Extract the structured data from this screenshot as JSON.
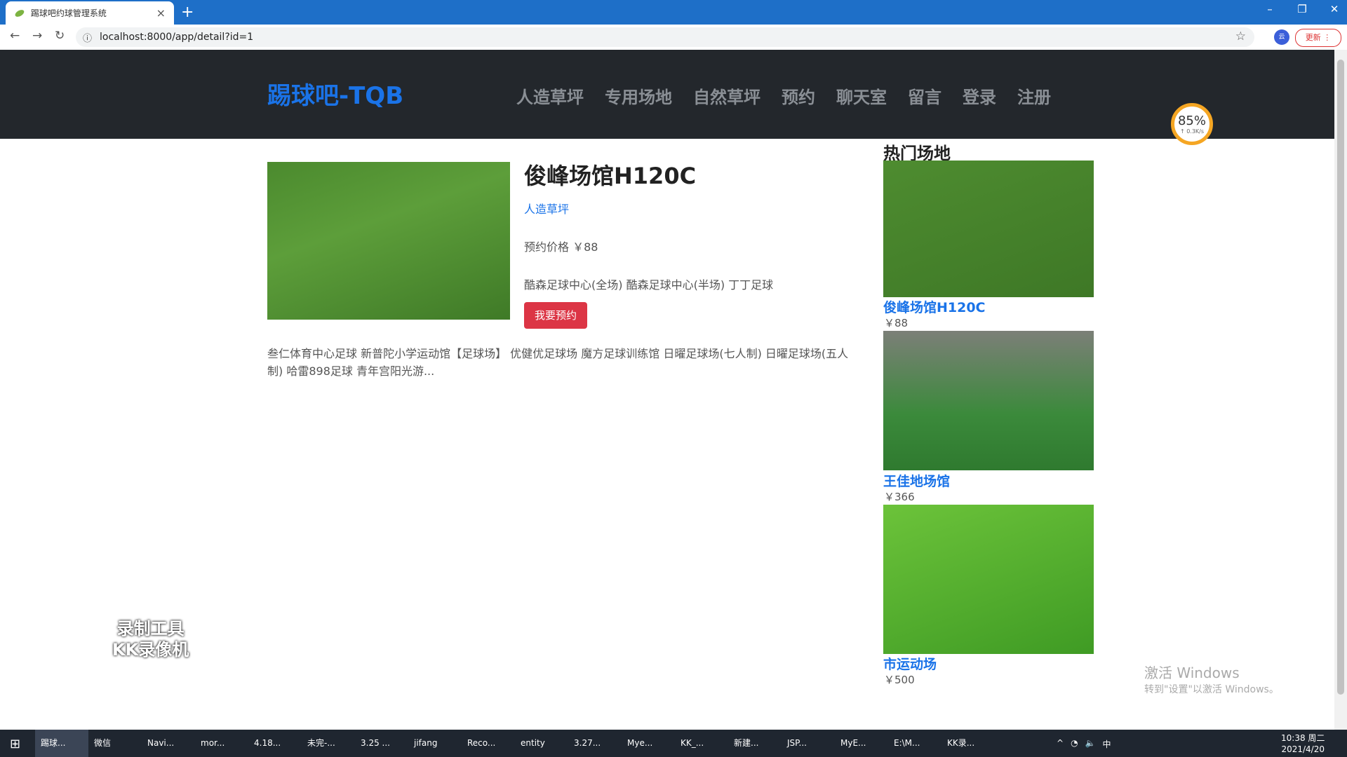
{
  "browser": {
    "tab_title": "踢球吧约球管理系统",
    "tab_close": "×",
    "new_tab": "+",
    "url": "localhost:8000/app/detail?id=1",
    "extension_label": "云",
    "update_label": "更新 ⋮"
  },
  "site": {
    "brand": "踢球吧-TQB",
    "nav": [
      "人造草坪",
      "专用场地",
      "自然草坪",
      "预约",
      "聊天室",
      "留言",
      "登录",
      "注册"
    ]
  },
  "speed_widget": {
    "percent": "85%",
    "rate": "↑ 0.3K/s"
  },
  "detail": {
    "title": "俊峰场馆H120C",
    "category": "人造草坪",
    "price": "预约价格 ￥88",
    "tags": "酷森足球中心(全场) 酷森足球中心(半场) 丁丁足球",
    "reserve_button": "我要预约",
    "description": "叁仁体育中心足球 新普陀小学运动馆【足球场】 优健优足球场 魔方足球训练馆 日曜足球场(七人制) 日曜足球场(五人制) 哈雷898足球 青年宫阳光游..."
  },
  "sidebar": {
    "title": "热门场地",
    "items": [
      {
        "name": "俊峰场馆H120C",
        "price": "￥88"
      },
      {
        "name": "王佳地场馆",
        "price": "￥366"
      },
      {
        "name": "市运动场",
        "price": "￥500"
      }
    ]
  },
  "overlay": {
    "recorder_line1": "录制工具",
    "recorder_line2": "KK录像机",
    "activate_line1": "激活 Windows",
    "activate_line2": "转到\"设置\"以激活 Windows。"
  },
  "taskbar": {
    "items": [
      "踢球...",
      "微信",
      "Navi...",
      "mor...",
      "4.18...",
      "未完-...",
      "3.25 ...",
      "jifang",
      "Reco...",
      "entity",
      "3.27...",
      "Mye...",
      "KK_...",
      "新建...",
      "JSP...",
      "MyE...",
      "E:\\M...",
      "KK录..."
    ],
    "ime": "中",
    "time": "10:38 周二",
    "date": "2021/4/20"
  }
}
